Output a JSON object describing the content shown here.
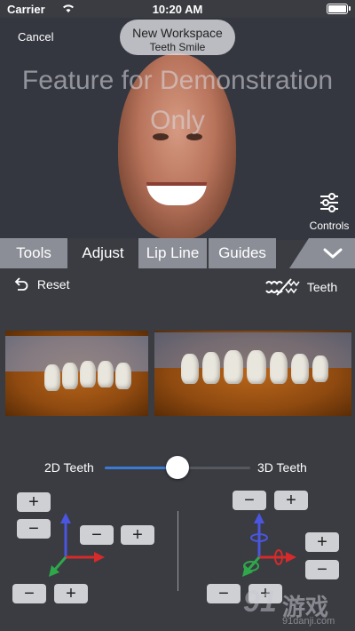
{
  "status_bar": {
    "carrier": "Carrier",
    "time": "10:20 AM"
  },
  "header": {
    "cancel_label": "Cancel",
    "workspace_title": "New Workspace",
    "workspace_subtitle": "Teeth Smile",
    "watermark": "Feature for Demonstration Only",
    "controls_label": "Controls"
  },
  "tabs": [
    {
      "label": "Tools"
    },
    {
      "label": "Adjust",
      "active": true
    },
    {
      "label": "Lip Line"
    },
    {
      "label": "Guides"
    }
  ],
  "toolbar": {
    "reset_label": "Reset",
    "teeth_label": "Teeth"
  },
  "slider": {
    "left_label": "2D Teeth",
    "right_label": "3D Teeth",
    "value": 0.5
  },
  "left_controls": {
    "plus": "+",
    "minus": "−"
  },
  "right_controls": {
    "plus": "+",
    "minus": "−"
  },
  "watermark_logo": {
    "number": "91",
    "text": "游戏",
    "url": "91danji.com"
  },
  "colors": {
    "background": "#3a3c41",
    "tab_inactive": "#8b8e96",
    "accent": "#3a7bd5",
    "button": "#cfd0d4"
  }
}
